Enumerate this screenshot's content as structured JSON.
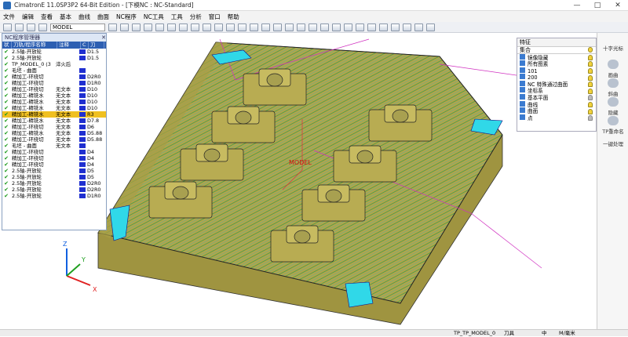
{
  "window": {
    "title": "CimatronE 11.0SP3P2 64-Bit Edition - [下模NC : NC-Standard]",
    "minimize": "—",
    "maximize": "□",
    "close": "✕"
  },
  "menu": [
    "文件",
    "编辑",
    "查看",
    "基本",
    "曲线",
    "曲面",
    "NC程序",
    "NC工具",
    "工具",
    "分析",
    "窗口",
    "帮助"
  ],
  "toolbar": {
    "model_select": "MODEL"
  },
  "nc_panel": {
    "title": "NC程序管理器",
    "close": "✕",
    "columns": [
      "状况",
      "刀轨/程序名称",
      "注释",
      "C",
      "刀"
    ],
    "rows": [
      {
        "name": "2.5轴-开放轮",
        "comment": "",
        "color": "#1f2fd0",
        "tool": "D1.5"
      },
      {
        "name": "2.5轴-开放轮",
        "comment": "",
        "color": "#1f2fd0",
        "tool": "D1.5"
      },
      {
        "name": "TP_MODEL_0 (3",
        "comment": "淬火后",
        "color": "",
        "tool": ""
      },
      {
        "name": "毛坯 - 曲面",
        "comment": "",
        "color": "#1f2fd0",
        "tool": ""
      },
      {
        "name": "精加工-环绕切",
        "comment": "",
        "color": "#1f2fd0",
        "tool": "D2R0"
      },
      {
        "name": "精加工-环绕切",
        "comment": "",
        "color": "#1f2fd0",
        "tool": "D1R0"
      },
      {
        "name": "精加工-环绕切",
        "comment": "无文本",
        "color": "#1f2fd0",
        "tool": "D10"
      },
      {
        "name": "精加工-精铣水",
        "comment": "无文本",
        "color": "#1f2fd0",
        "tool": "D10"
      },
      {
        "name": "精加工-精铣水",
        "comment": "无文本",
        "color": "#1f2fd0",
        "tool": "D10"
      },
      {
        "name": "精加工-精铣水",
        "comment": "无文本",
        "color": "#1f2fd0",
        "tool": "D10"
      },
      {
        "name": "精加工-精铣水",
        "comment": "无文本",
        "color": "#1f2fd0",
        "tool": "R3"
      },
      {
        "name": "精加工-精铣水",
        "comment": "无文本",
        "color": "#1f2fd0",
        "tool": "D7.8"
      },
      {
        "name": "精加工-环绕切",
        "comment": "无文本",
        "color": "#1f2fd0",
        "tool": "D6"
      },
      {
        "name": "精加工-精铣水",
        "comment": "无文本",
        "color": "#1f2fd0",
        "tool": "D5.88"
      },
      {
        "name": "精加工-环绕切",
        "comment": "无文本",
        "color": "#1f2fd0",
        "tool": "D5.88"
      },
      {
        "name": "毛坯 - 曲面",
        "comment": "无文本",
        "color": "#1f2fd0",
        "tool": ""
      },
      {
        "name": "精加工-环绕切",
        "comment": "",
        "color": "#1f2fd0",
        "tool": "D4"
      },
      {
        "name": "精加工-环绕切",
        "comment": "",
        "color": "#1f2fd0",
        "tool": "D4"
      },
      {
        "name": "精加工-环绕切",
        "comment": "",
        "color": "#1f2fd0",
        "tool": "D4"
      },
      {
        "name": "2.5轴-开放轮",
        "comment": "",
        "color": "#1f2fd0",
        "tool": "D5"
      },
      {
        "name": "2.5轴-开放轮",
        "comment": "",
        "color": "#1f2fd0",
        "tool": "D5"
      },
      {
        "name": "2.5轴-开放轮",
        "comment": "",
        "color": "#1f2fd0",
        "tool": "D2R0"
      },
      {
        "name": "2.5轴-开放轮",
        "comment": "",
        "color": "#1f2fd0",
        "tool": "D2R0"
      },
      {
        "name": "2.5轴-开放轮",
        "comment": "",
        "color": "#1f2fd0",
        "tool": "D1R0"
      }
    ]
  },
  "features_panel": {
    "title": "特征",
    "header": "集合",
    "rows": [
      {
        "label": "镜像隐藏",
        "on": true
      },
      {
        "label": "所有图素",
        "on": true
      },
      {
        "label": "101",
        "on": true
      },
      {
        "label": "200",
        "on": true
      },
      {
        "label": "NC 特殊通过曲面",
        "on": true
      },
      {
        "label": "坐标系",
        "on": true
      },
      {
        "label": "基本平面",
        "on": false
      },
      {
        "label": "曲线",
        "on": true
      },
      {
        "label": "曲面",
        "on": true
      },
      {
        "label": "点",
        "on": false
      }
    ]
  },
  "right_sidebar": {
    "items": [
      "十字光标",
      "画曲",
      "斜曲",
      "隐藏",
      "TP重命名",
      "一键处理"
    ]
  },
  "viewport": {
    "label_model": "MODEL",
    "axis_x": "X",
    "axis_y": "Y",
    "axis_z": "Z"
  },
  "status": {
    "model": "TP_TP_MODEL_0",
    "tool": "刀具",
    "eng": "中",
    "mm": "M/毫米"
  }
}
